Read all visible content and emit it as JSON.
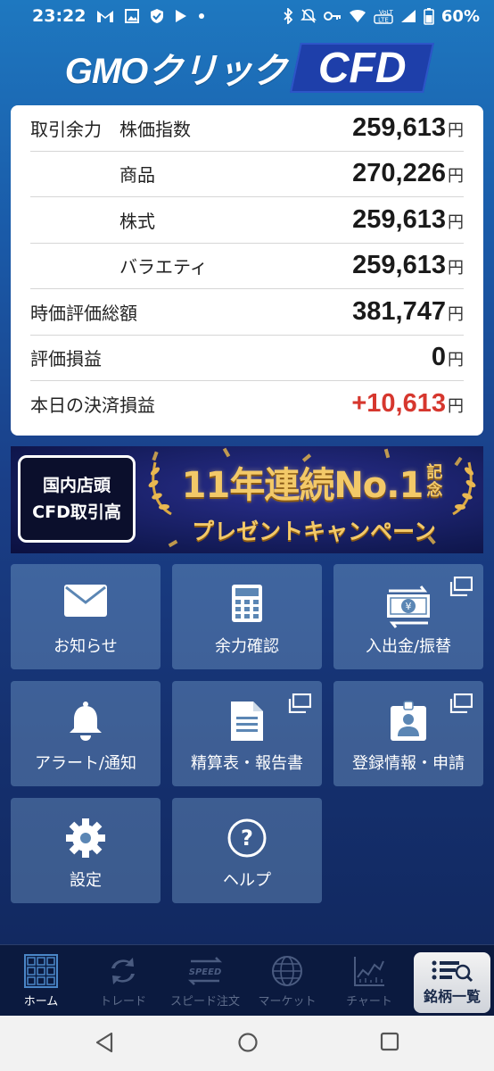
{
  "status_bar": {
    "time": "23:22",
    "battery": "60%",
    "left_icons": [
      "gmail-icon",
      "image-icon",
      "shield-icon",
      "play-icon",
      "dot-icon"
    ],
    "right_icons": [
      "bluetooth-icon",
      "mute-icon",
      "key-icon",
      "wifi-icon",
      "lte-icon",
      "signal-icon",
      "battery-icon"
    ]
  },
  "logo": {
    "text": "GMOクリック",
    "badge": "CFD"
  },
  "balance": {
    "rows": [
      {
        "label1": "取引余力",
        "label2": "株価指数",
        "value": "259,613",
        "unit": "円"
      },
      {
        "label1": "",
        "label2": "商品",
        "value": "270,226",
        "unit": "円"
      },
      {
        "label1": "",
        "label2": "株式",
        "value": "259,613",
        "unit": "円"
      },
      {
        "label1": "",
        "label2": "バラエティ",
        "value": "259,613",
        "unit": "円"
      },
      {
        "label": "時価評価総額",
        "value": "381,747",
        "unit": "円"
      },
      {
        "label": "評価損益",
        "value": "0",
        "unit": "円"
      },
      {
        "label": "本日の決済損益",
        "value": "+10,613",
        "unit": "円"
      }
    ]
  },
  "banner": {
    "box_line1": "国内店頭",
    "box_line2": "CFD取引高",
    "main_line1": "11年連続No.1",
    "badge_text": "記念",
    "main_line2": "プレゼントキャンペーン"
  },
  "tiles": [
    {
      "label": "お知らせ",
      "icon": "mail-icon",
      "external": false
    },
    {
      "label": "余力確認",
      "icon": "calculator-icon",
      "external": false
    },
    {
      "label": "入出金/振替",
      "icon": "yen-transfer-icon",
      "external": true
    },
    {
      "label": "アラート/通知",
      "icon": "bell-icon",
      "external": false
    },
    {
      "label": "精算表・報告書",
      "icon": "document-icon",
      "external": true
    },
    {
      "label": "登録情報・申請",
      "icon": "id-badge-icon",
      "external": true
    },
    {
      "label": "設定",
      "icon": "gear-icon",
      "external": false
    },
    {
      "label": "ヘルプ",
      "icon": "help-icon",
      "external": false
    }
  ],
  "bottom_nav": {
    "items": [
      {
        "label": "ホーム",
        "active": true
      },
      {
        "label": "トレード",
        "active": false
      },
      {
        "label": "スピード注文",
        "active": false,
        "icon_text": "SPEED"
      },
      {
        "label": "マーケット",
        "active": false
      },
      {
        "label": "チャート",
        "active": false
      }
    ],
    "brand_list": "銘柄一覧"
  },
  "colors": {
    "positive": "#d6372e",
    "accent": "#1e3faa",
    "gold": "#f3c968"
  }
}
